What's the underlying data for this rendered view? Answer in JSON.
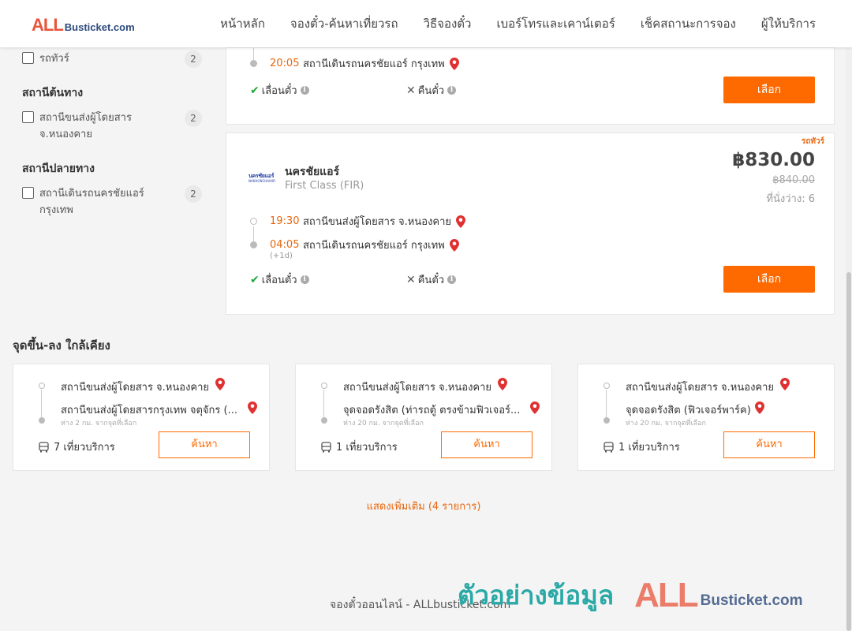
{
  "header": {
    "logo_all": "ALL",
    "logo_rest": "Busticket.com",
    "nav": [
      "หน้าหลัก",
      "จองตั๋ว-ค้นหาเที่ยวรถ",
      "วิธีจองตั๋ว",
      "เบอร์โทรและเคาน์เตอร์",
      "เช็คสถานะการจอง",
      "ผู้ให้บริการ"
    ]
  },
  "sidebar": {
    "bus_type_item": {
      "label": "รถทัวร์",
      "count": "2"
    },
    "origin_title": "สถานีต้นทาง",
    "origin_item": {
      "label": "สถานีขนส่งผู้โดยสาร จ.หนองคาย",
      "count": "2"
    },
    "dest_title": "สถานีปลายทาง",
    "dest_item": {
      "label": "สถานีเดินรถนครชัยแอร์ กรุงเทพ",
      "count": "2"
    }
  },
  "trip1": {
    "arrive_time": "20:05",
    "arrive_station": "สถานีเดินรถนครชัยแอร์ กรุงเทพ",
    "reschedule": "เลื่อนตั๋ว",
    "refund": "คืนตั๋ว",
    "select": "เลือก"
  },
  "trip2": {
    "tag": "รถทัวร์",
    "logo_top": "นครชัยแอร์",
    "logo_bottom": "NAKHONCHAIAIR",
    "operator": "นครชัยแอร์",
    "class": "First Class (FIR)",
    "price": "฿830.00",
    "old_price": "฿840.00",
    "seats": "ที่นั่งว่าง: 6",
    "depart_time": "19:30",
    "depart_station": "สถานีขนส่งผู้โดยสาร จ.หนองคาย",
    "arrive_time": "04:05",
    "arrive_station": "สถานีเดินรถนครชัยแอร์ กรุงเทพ",
    "next_day": "(+1d)",
    "reschedule": "เลื่อนตั๋ว",
    "refund": "คืนตั๋ว",
    "select": "เลือก"
  },
  "nearby": {
    "title": "จุดขึ้น-ลง ใกล้เคียง",
    "cards": [
      {
        "from": "สถานีขนส่งผู้โดยสาร จ.หนองคาย",
        "to": "สถานีขนส่งผู้โดยสารกรุงเทพ จตุจักร (...",
        "distance": "ห่าง 2 กม. จากจุดที่เลือก",
        "trips": "7 เที่ยวบริการ",
        "button": "ค้นหา"
      },
      {
        "from": "สถานีขนส่งผู้โดยสาร จ.หนองคาย",
        "to": "จุดจอดรังสิต (ท่ารถตู้ ตรงข้ามฟิวเจอร์...",
        "distance": "ห่าง 20 กม. จากจุดที่เลือก",
        "trips": "1 เที่ยวบริการ",
        "button": "ค้นหา"
      },
      {
        "from": "สถานีขนส่งผู้โดยสาร จ.หนองคาย",
        "to": "จุดจอดรังสิต (ฟิวเจอร์พาร์ค)",
        "distance": "ห่าง 20 กม. จากจุดที่เลือก",
        "trips": "1 เที่ยวบริการ",
        "button": "ค้นหา"
      }
    ]
  },
  "show_more": "แสดงเพิ่มเติม (4 รายการ)",
  "footer": "จองตั๋วออนไลน์ - ALLbusticket.com",
  "watermark": {
    "thai": "ตัวอย่างข้อมูล",
    "all": "ALL",
    "rest": "Busticket.com"
  },
  "colors": {
    "accent": "#ff6a00",
    "time": "#e8660f",
    "check": "#1fa83a",
    "pin": "#e03131"
  },
  "icons": [
    "map-pin-icon",
    "check-icon",
    "x-icon",
    "info-icon",
    "bus-icon"
  ]
}
